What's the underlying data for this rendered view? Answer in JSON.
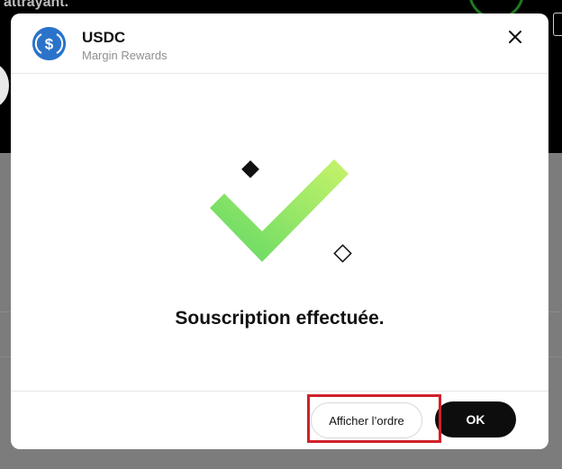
{
  "background": {
    "text": "attrayant."
  },
  "modal": {
    "coin_icon": "usdc-dollar-icon",
    "title": "USDC",
    "subtitle": "Margin Rewards",
    "close_icon": "close-icon",
    "message": "Souscription effectuée.",
    "buttons": {
      "secondary_label": "Afficher l’ordre",
      "primary_label": "OK"
    }
  },
  "colors": {
    "coin": "#2a73c9",
    "check_start": "#b6f05a",
    "check_end": "#5ed865",
    "primary_button": "#0d0d0d",
    "highlight": "#d0202a"
  }
}
